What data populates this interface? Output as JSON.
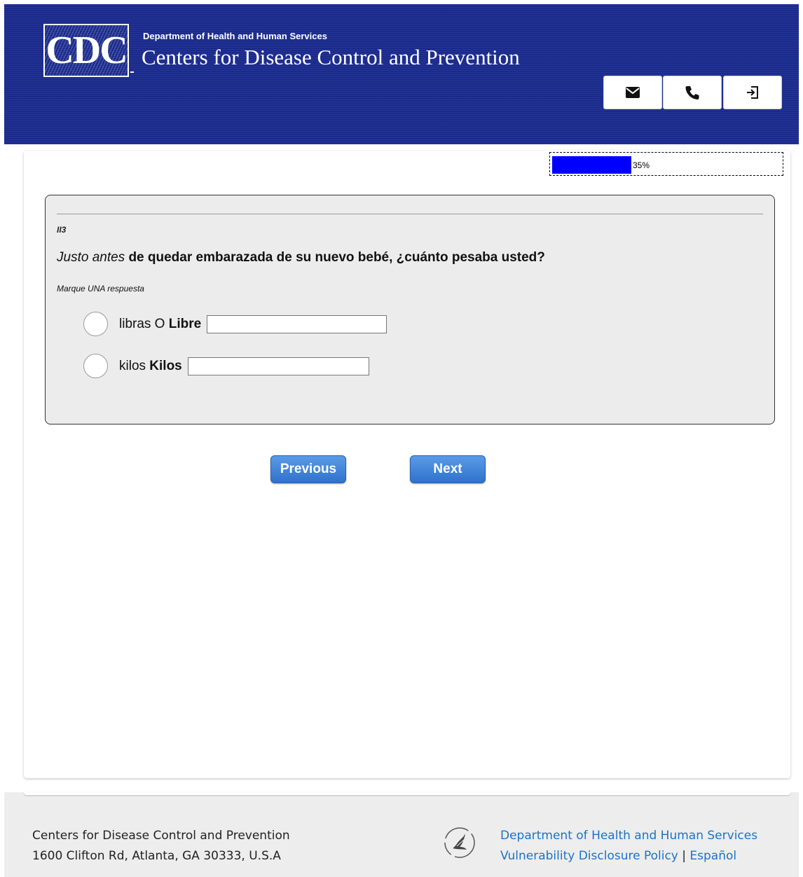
{
  "header": {
    "logo_text": "CDC",
    "department": "Department of Health and Human Services",
    "agency": "Centers for Disease Control and Prevention",
    "buttons": [
      {
        "icon": "email-icon"
      },
      {
        "icon": "phone-icon"
      },
      {
        "icon": "exit-icon"
      }
    ]
  },
  "progress": {
    "percent": 35,
    "label": "35%"
  },
  "question": {
    "id": "II3",
    "text_emphasis": "Justo antes",
    "text_rest": " de quedar embarazada de su nuevo bebé, ¿cuánto pesaba usted?",
    "instruction": "Marque UNA respuesta",
    "options": [
      {
        "label": "libras O",
        "bold_label": "Libre",
        "value": ""
      },
      {
        "label": "kilos",
        "bold_label": "Kilos",
        "value": ""
      }
    ]
  },
  "nav": {
    "previous": "Previous",
    "next": "Next"
  },
  "footer": {
    "org_name": "Centers for Disease Control and Prevention",
    "address": "1600 Clifton Rd, Atlanta, GA 30333, U.S.A",
    "hhs_link": "Department of Health and Human Services",
    "vdp_link": "Vulnerability Disclosure Policy",
    "separator": "|",
    "espanol_link": "Español"
  },
  "colors": {
    "header_bg": "#1a2a8c",
    "progress_fill": "#0000ff",
    "button_blue": "#3a7fd5",
    "link_blue": "#1a73c8",
    "question_bg": "#ececec"
  }
}
